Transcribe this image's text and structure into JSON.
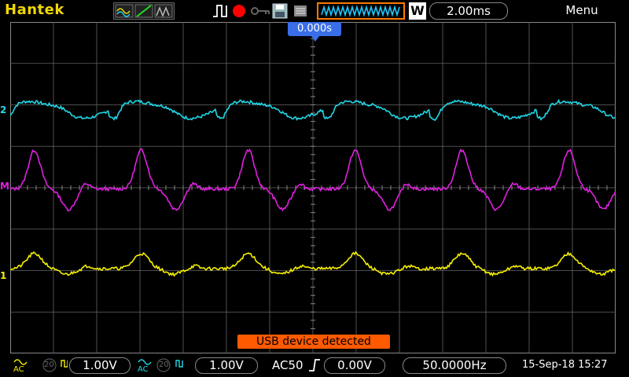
{
  "header": {
    "brand": "Hantek",
    "timebase": "2.00ms",
    "window_label": "W",
    "menu_label": "Menu"
  },
  "screen": {
    "trigger_time": "0.000s",
    "notification": "USB device detected",
    "channel_markers": {
      "ch2": "2",
      "math": "M",
      "ch1": "1"
    }
  },
  "footer": {
    "ch1_coupling": "AC",
    "ch1_bw": "20",
    "ch1_scale": "1.00V",
    "ch2_coupling": "AC",
    "ch2_bw": "20",
    "ch2_scale": "1.00V",
    "trigger_source": "AC50",
    "trigger_level": "0.00V",
    "frequency": "50.0000Hz",
    "datetime": "15-Sep-18 15:27"
  },
  "colors": {
    "ch1": "#f5f000",
    "ch2": "#20d8e8",
    "math": "#e020e0",
    "brand": "#f0d800",
    "accent": "#ff7a00",
    "trigger": "#3a6ee8"
  }
}
